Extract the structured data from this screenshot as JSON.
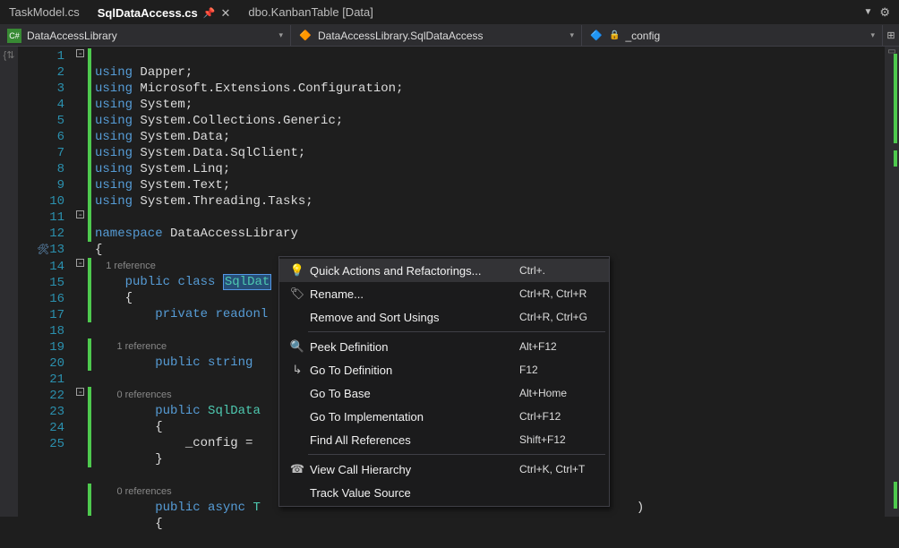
{
  "tabs": {
    "inactive1": "TaskModel.cs",
    "active": "SqlDataAccess.cs",
    "inactive2": "dbo.KanbanTable [Data]"
  },
  "nav": {
    "project": "DataAccessLibrary",
    "class": "DataAccessLibrary.SqlDataAccess",
    "member": "_config"
  },
  "gutter_lines": [
    "1",
    "2",
    "3",
    "4",
    "5",
    "6",
    "7",
    "8",
    "9",
    "10",
    "11",
    "12",
    "",
    "13",
    "14",
    "15",
    "16",
    "",
    "17",
    "18",
    "",
    "19",
    "20",
    "21",
    "22",
    "23",
    "",
    "24",
    "25"
  ],
  "folds": [
    "m",
    "",
    "",
    "",
    "",
    "",
    "",
    "",
    "",
    "",
    "m",
    "",
    "",
    "m",
    "",
    "",
    "",
    "",
    "",
    "",
    "",
    "m",
    "",
    "",
    "",
    "",
    "",
    "",
    ""
  ],
  "screw_line_index": 13,
  "codelens": {
    "ref1": "1 reference",
    "ref0": "0 references"
  },
  "code": {
    "using": "using",
    "dapper": "Dapper",
    "msc": "Microsoft.Extensions.Configuration",
    "system": "System",
    "coll": "System.Collections.Generic",
    "data": "System.Data",
    "sqlc": "System.Data.SqlClient",
    "linq": "System.Linq",
    "text": "System.Text",
    "tasks": "System.Threading.Tasks",
    "namespace": "namespace",
    "lib": "DataAccessLibrary",
    "brace_open": "{",
    "brace_close": "}",
    "public": "public",
    "class": "class",
    "sqlda": "SqlDat",
    "private": "private",
    "readonly": "readonl",
    "string": "string",
    "ctorname": "SqlData",
    "assign": "_config = ",
    "async": "async",
    "task": "T",
    "paren": ")"
  },
  "menu": {
    "quick": "Quick Actions and Refactorings...",
    "quick_sc": "Ctrl+.",
    "rename": "Rename...",
    "rename_sc": "Ctrl+R, Ctrl+R",
    "remove": "Remove and Sort Usings",
    "remove_sc": "Ctrl+R, Ctrl+G",
    "peek": "Peek Definition",
    "peek_sc": "Alt+F12",
    "gotodef": "Go To Definition",
    "gotodef_sc": "F12",
    "gotobase": "Go To Base",
    "gotobase_sc": "Alt+Home",
    "gotoimpl": "Go To Implementation",
    "gotoimpl_sc": "Ctrl+F12",
    "findref": "Find All References",
    "findref_sc": "Shift+F12",
    "callhier": "View Call Hierarchy",
    "callhier_sc": "Ctrl+K, Ctrl+T",
    "track": "Track Value Source"
  }
}
